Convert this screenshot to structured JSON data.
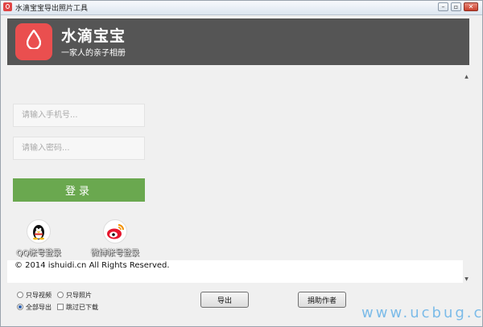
{
  "window": {
    "title": "水滴宝宝导出照片工具",
    "controls": [
      "minimize-icon",
      "restore-icon",
      "close-icon"
    ]
  },
  "header": {
    "app_name": "水滴宝宝",
    "tagline": "一家人的亲子相册",
    "background": "#555555",
    "logo_color": "#ea4f4f"
  },
  "login": {
    "phone_placeholder": "请输入手机号...",
    "password_placeholder": "请输入密码...",
    "login_label": "登录",
    "login_color": "#6aa84f"
  },
  "social": {
    "qq_label": "QQ帐号登录",
    "weibo_label": "微博帐号登录"
  },
  "footer": {
    "copyright": "© 2014 ishuidi.cn All Rights Reserved."
  },
  "options": {
    "radio1": "只导视频",
    "radio2": "只导照片",
    "radio3": "全部导出",
    "radio_selected": "全部导出",
    "checkbox": "跳过已下载",
    "checkbox_checked": false
  },
  "buttons": {
    "export": "导出",
    "donate": "捐助作者"
  },
  "watermark": "www.ucbug.cc"
}
